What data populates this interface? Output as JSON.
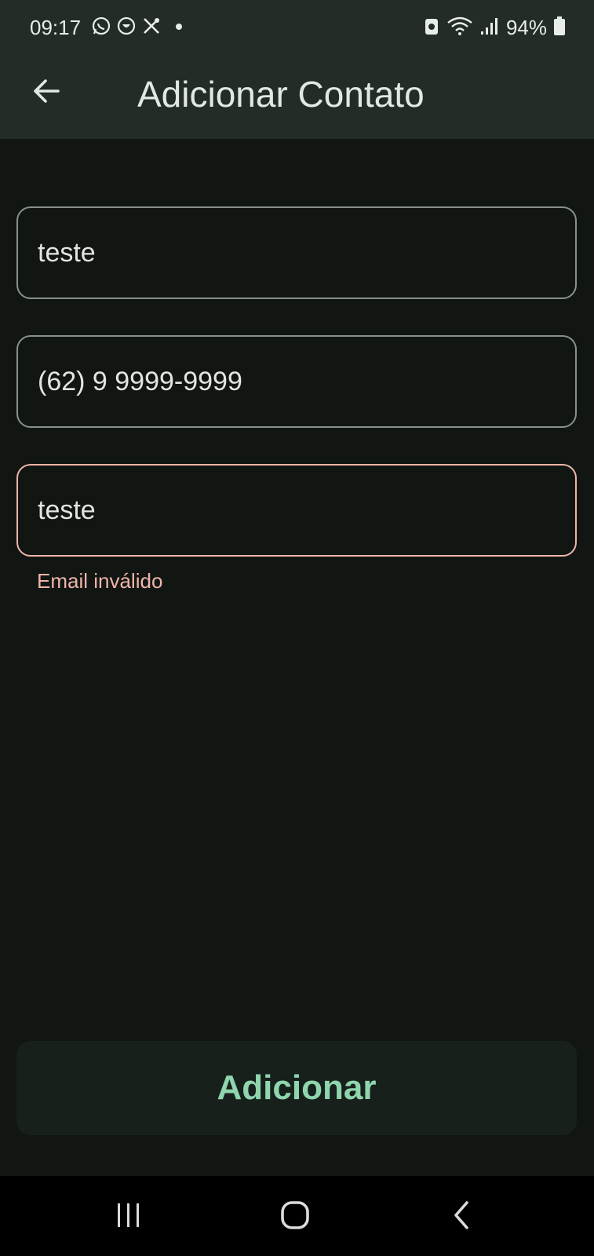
{
  "status_bar": {
    "time": "09:17",
    "left_icons": [
      "whatsapp-icon",
      "vpn-shield-icon",
      "tools-icon",
      "dot-icon"
    ],
    "right_icons": [
      "battery-saver-icon",
      "wifi-icon",
      "signal-icon",
      "battery-icon"
    ],
    "battery_percent": "94%"
  },
  "app_bar": {
    "title": "Adicionar Contato",
    "back_icon": "arrow-back-icon"
  },
  "form": {
    "name_value": "teste",
    "phone_value": "(62) 9 9999-9999",
    "email_value": "teste",
    "email_error": "Email inválido"
  },
  "actions": {
    "add_label": "Adicionar"
  },
  "nav_bar": {
    "buttons": [
      "recents-icon",
      "home-icon",
      "back-icon"
    ]
  },
  "colors": {
    "background": "#111613",
    "app_bar": "#232c27",
    "accent": "#8fd6ae",
    "error": "#f1b4a8",
    "outline": "#8a918c"
  }
}
